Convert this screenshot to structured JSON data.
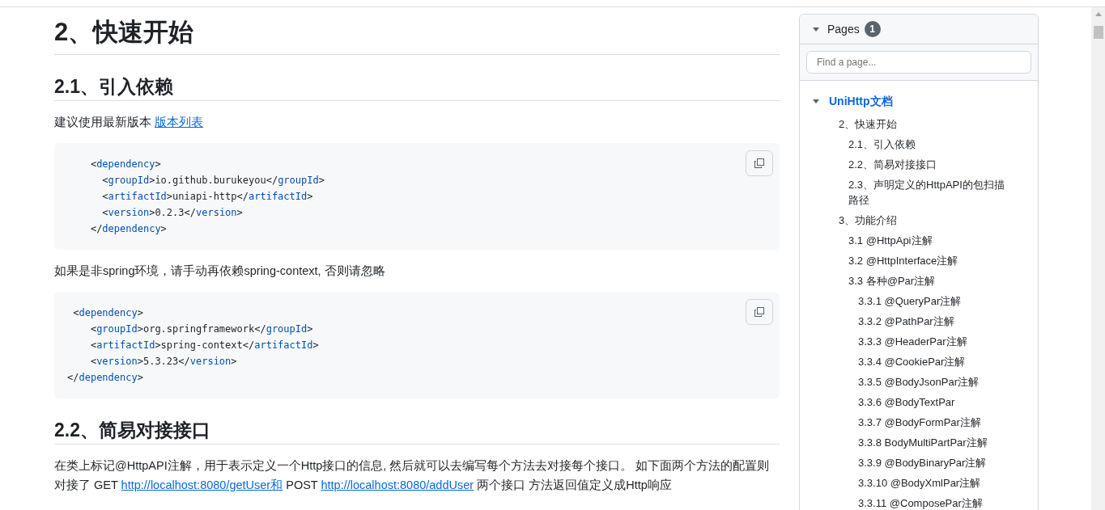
{
  "content": [
    {
      "kind": "h1",
      "text": "2、快速开始"
    },
    {
      "kind": "h2",
      "text": "2.1、引入依赖"
    },
    {
      "kind": "para",
      "parts": [
        {
          "text": "建议使用最新版本 "
        },
        {
          "link": "版本列表"
        }
      ]
    },
    {
      "kind": "code",
      "lines": [
        "    <dependency>",
        "      <groupId>io.github.burukeyou</groupId>",
        "      <artifactId>uniapi-http</artifactId>",
        "      <version>0.2.3</version>",
        "    </dependency>"
      ]
    },
    {
      "kind": "para",
      "parts": [
        {
          "text": "如果是非spring环境，请手动再依赖spring-context, 否则请忽略"
        }
      ]
    },
    {
      "kind": "code",
      "lines": [
        " <dependency>",
        "    <groupId>org.springframework</groupId>",
        "    <artifactId>spring-context</artifactId>",
        "    <version>5.3.23</version>",
        "</dependency>"
      ]
    },
    {
      "kind": "h2",
      "text": "2.2、简易对接接口"
    },
    {
      "kind": "para",
      "parts": [
        {
          "text": "在类上标记@HttpAPI注解，用于表示定义一个Http接口的信息, 然后就可以去编写每个方法去对接每个接口。 如下面两个方法的配置则对接了 GET "
        },
        {
          "link": "http://localhost:8080/getUser和"
        },
        {
          "text": " POST "
        },
        {
          "link": "http://localhost:8080/addUser"
        },
        {
          "text": " 两个接口 方法返回值定义成Http响应"
        }
      ]
    }
  ],
  "sidebar": {
    "title": "Pages",
    "count": "1",
    "search": {
      "placeholder": "Find a page..."
    },
    "tree": [
      {
        "label": "UniHttp文档",
        "expanded": true,
        "children": [
          {
            "label": "2、快速开始",
            "children": [
              {
                "label": "2.1、引入依赖"
              },
              {
                "label": "2.2、简易对接接口"
              },
              {
                "label": "2.3、声明定义的HttpAPI的包扫描路径"
              }
            ]
          },
          {
            "label": "3、功能介绍",
            "children": [
              {
                "label": "3.1 @HttpApi注解"
              },
              {
                "label": "3.2 @HttpInterface注解"
              },
              {
                "label": "3.3 各种@Par注解",
                "children": [
                  {
                    "label": "3.3.1 @QueryPar注解"
                  },
                  {
                    "label": "3.3.2 @PathPar注解"
                  },
                  {
                    "label": "3.3.3 @HeaderPar注解"
                  },
                  {
                    "label": "3.3.4 @CookiePar注解"
                  },
                  {
                    "label": "3.3.5 @BodyJsonPar注解"
                  },
                  {
                    "label": "3.3.6 @BodyTextPar"
                  },
                  {
                    "label": "3.3.7 @BodyFormPar注解"
                  },
                  {
                    "label": "3.3.8 BodyMultiPartPar注解"
                  },
                  {
                    "label": "3.3.9 @BodyBinaryPar注解"
                  },
                  {
                    "label": "3.3.10 @BodyXmlPar注解"
                  },
                  {
                    "label": "3.3.11 @ComposePar注解"
                  }
                ]
              }
            ]
          }
        ]
      }
    ]
  }
}
